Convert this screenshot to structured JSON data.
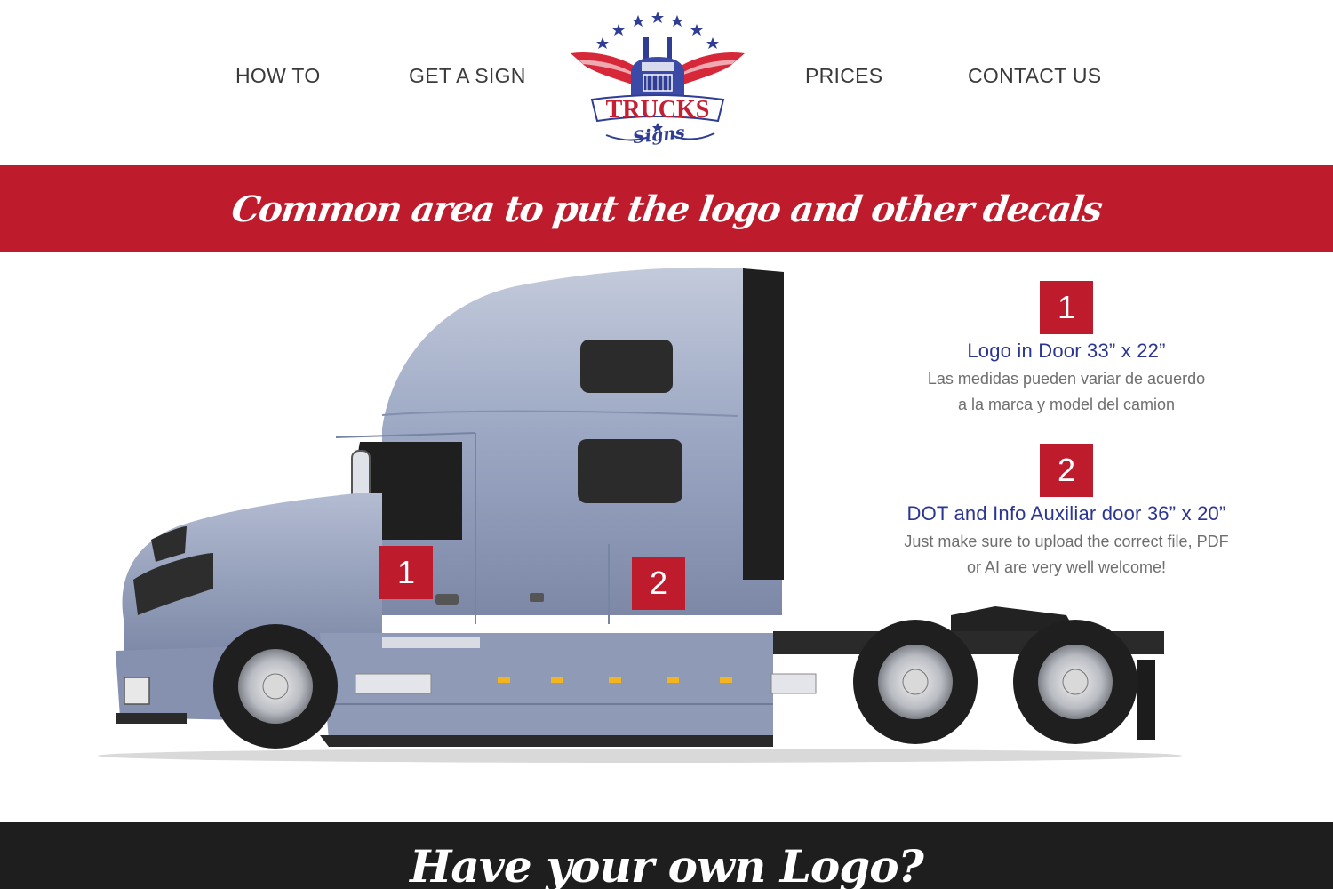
{
  "nav": {
    "how_to": "HOW TO",
    "get_a_sign": "GET A SIGN",
    "prices": "PRICES",
    "contact_us": "CONTACT US"
  },
  "logo": {
    "wordmark": "TRUCKS",
    "subtitle": "Signs"
  },
  "banner": {
    "title": "Common area to put the logo and other decals"
  },
  "placements": [
    {
      "number": "1",
      "title": "Logo in Door  33” x 22”",
      "note_line1": "Las medidas pueden variar de acuerdo",
      "note_line2": "a la marca y model del camion"
    },
    {
      "number": "2",
      "title": "DOT and Info Auxiliar door  36” x 20”",
      "note_line1": "Just make sure to upload the correct file, PDF",
      "note_line2": "or AI are very well welcome!"
    }
  ],
  "truck": {
    "door_marker_1": "1",
    "door_marker_2": "2"
  },
  "bottom": {
    "title": "Have your own  Logo?"
  },
  "colors": {
    "brand_red": "#be1c2d",
    "brand_blue": "#2b3592",
    "dark_band": "#1e1e1e"
  }
}
